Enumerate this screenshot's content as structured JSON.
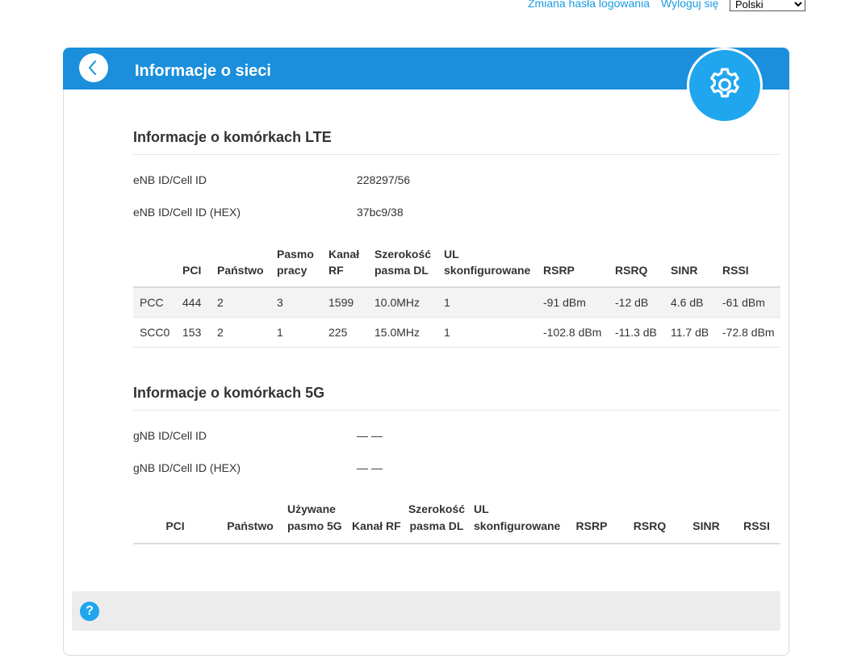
{
  "topbar": {
    "change_password": "Zmiana hasła logowania",
    "logout": "Wyloguj się",
    "language": "Polski"
  },
  "header": {
    "title": "Informacje o sieci"
  },
  "lte": {
    "title": "Informacje o komórkach LTE",
    "enb_label": "eNB ID/Cell ID",
    "enb_value": "228297/56",
    "enb_hex_label": "eNB ID/Cell ID (HEX)",
    "enb_hex_value": "37bc9/38",
    "columns": [
      "",
      "PCI",
      "Państwo",
      "Pasmo pracy",
      "Kanał RF",
      "Szerokość pasma DL",
      "UL skonfigurowane",
      "RSRP",
      "RSRQ",
      "SINR",
      "RSSI"
    ],
    "rows": [
      [
        "PCC",
        "444",
        "2",
        "3",
        "1599",
        "10.0MHz",
        "1",
        "-91 dBm",
        "-12 dB",
        "4.6 dB",
        "-61 dBm"
      ],
      [
        "SCC0",
        "153",
        "2",
        "1",
        "225",
        "15.0MHz",
        "1",
        "-102.8 dBm",
        "-11.3 dB",
        "11.7 dB",
        "-72.8 dBm"
      ]
    ]
  },
  "nr": {
    "title": "Informacje o komórkach 5G",
    "gnb_label": "gNB ID/Cell ID",
    "gnb_value": "— —",
    "gnb_hex_label": "gNB ID/Cell ID (HEX)",
    "gnb_hex_value": "— —",
    "columns": [
      "PCI",
      "Państwo",
      "Używane pasmo 5G",
      "Kanał RF",
      "Szerokość pasma DL",
      "UL skonfigurowane",
      "RSRP",
      "RSRQ",
      "SINR",
      "RSSI"
    ]
  },
  "help": {
    "icon_label": "?"
  },
  "colors": {
    "header_blue": "#1b8fdc",
    "accent_blue": "#1fa6ee",
    "link_blue": "#1a9be3"
  },
  "icons": {
    "back": "chevron-left-icon",
    "settings": "gear-icon",
    "help": "help-icon"
  }
}
